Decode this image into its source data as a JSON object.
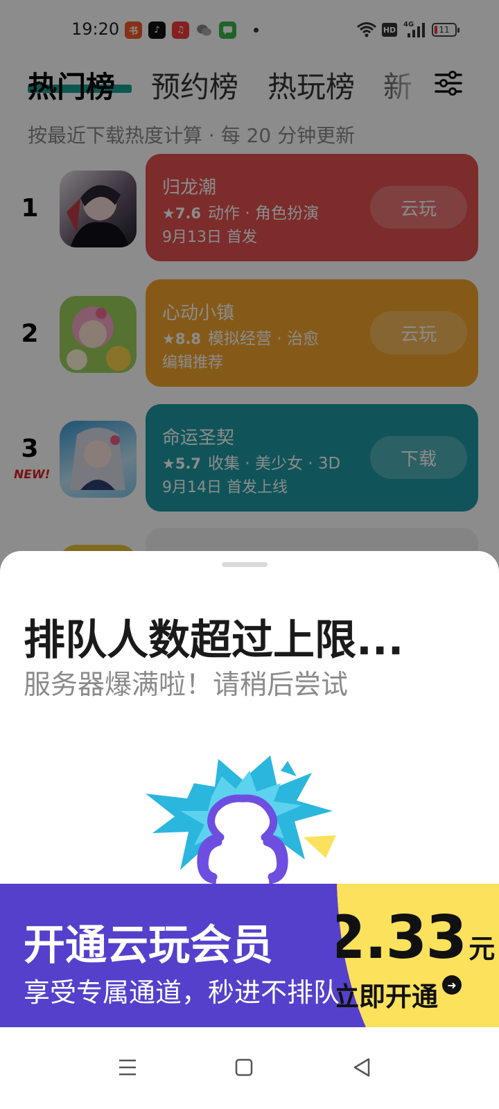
{
  "status_bar": {
    "time": "19:20",
    "notification_icons": [
      "xiaohongshu-icon",
      "douyin-icon",
      "music-icon",
      "wechat-icon",
      "messages-icon"
    ],
    "network": "4G",
    "hd_label": "HD",
    "battery": "11"
  },
  "tabs": [
    {
      "label": "热门榜",
      "active": true
    },
    {
      "label": "预约榜",
      "active": false
    },
    {
      "label": "热玩榜",
      "active": false
    },
    {
      "label": "新",
      "active": false
    }
  ],
  "filter_icon": "filter-sliders-icon",
  "subtitle": "按最近下载热度计算 · 每 20 分钟更新",
  "games": [
    {
      "rank": "1",
      "name": "归龙潮",
      "score": "7.6",
      "tags": "动作 · 角色扮演",
      "note": "9月13日 首发",
      "button": "云玩",
      "color": "#e0504f",
      "new": ""
    },
    {
      "rank": "2",
      "name": "心动小镇",
      "score": "8.8",
      "tags": "模拟经营 · 治愈",
      "note": "编辑推荐",
      "button": "云玩",
      "color": "#f2a42c",
      "new": ""
    },
    {
      "rank": "3",
      "name": "命运圣契",
      "score": "5.7",
      "tags": "收集 · 美少女 · 3D",
      "note": "9月14日 首发上线",
      "button": "下载",
      "color": "#1e9aa3",
      "new": "NEW!"
    }
  ],
  "sheet": {
    "title": "排队人数超过上限...",
    "subtitle": "服务器爆满啦！请稍后尝试"
  },
  "promo": {
    "title": "开通云玩会员",
    "subtitle": "享受专属通道，秒进不排队",
    "price": "2.33",
    "unit": "元",
    "cta": "立即开通",
    "colors": {
      "purple": "#5540cc",
      "yellow": "#fbe15c"
    }
  },
  "nav": [
    "menu-icon",
    "home-icon",
    "back-icon"
  ]
}
